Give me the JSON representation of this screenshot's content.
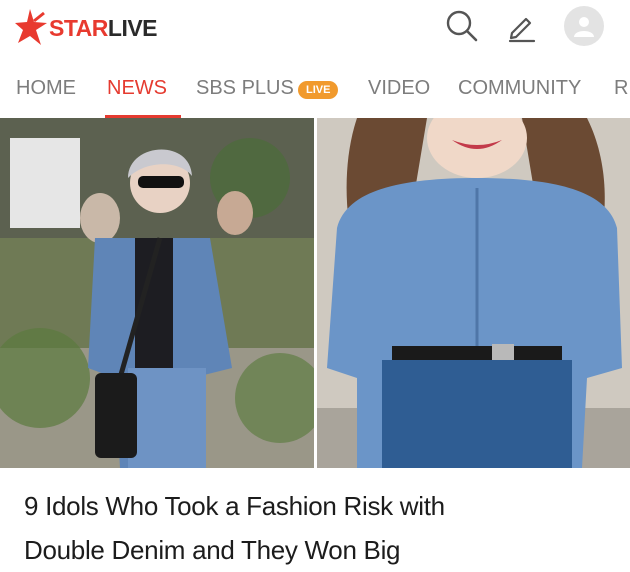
{
  "header": {
    "logo_star": "STAR",
    "logo_live": "LIVE",
    "brand_color": "#e83a2f",
    "icons": [
      "search-icon",
      "pencil-icon",
      "user-avatar-icon"
    ]
  },
  "nav": {
    "items": [
      {
        "label": "HOME"
      },
      {
        "label": "NEWS",
        "active": true
      },
      {
        "label": "SBS PLUS"
      },
      {
        "label": "VIDEO"
      },
      {
        "label": "COMMUNITY"
      },
      {
        "label": "R."
      }
    ],
    "live_badge": "LIVE",
    "active_color": "#e53b30",
    "badge_color": "#f19a2d"
  },
  "article": {
    "headline_line1": "9 Idols Who Took a Fashion Risk with",
    "headline_line2": "Double Denim and They Won Big"
  }
}
